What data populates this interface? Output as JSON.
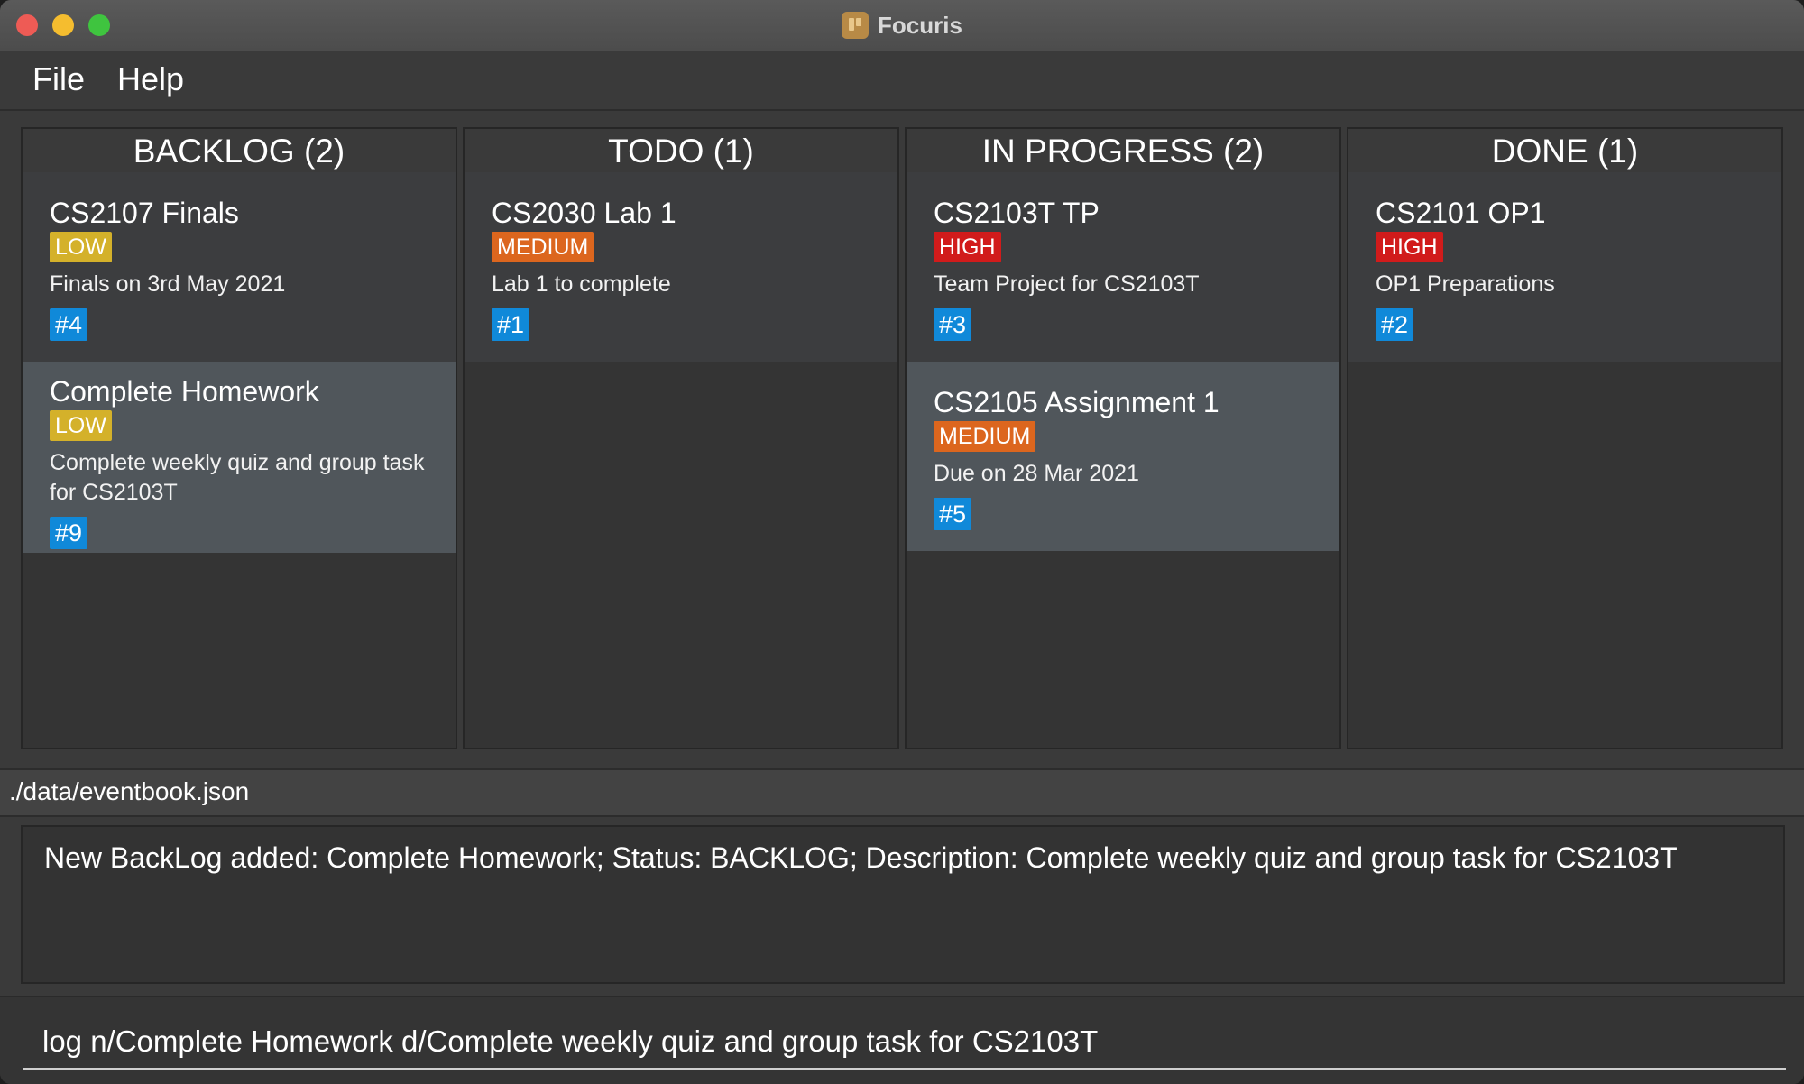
{
  "window": {
    "title": "Focuris"
  },
  "menu": [
    "File",
    "Help"
  ],
  "columns": [
    {
      "header": "BACKLOG (2)",
      "cards": [
        {
          "title": "CS2107 Finals",
          "priority": "LOW",
          "description": "Finals on 3rd May 2021",
          "id": "#4"
        },
        {
          "title": "Complete Homework",
          "priority": "LOW",
          "description": "Complete weekly quiz and group task for CS2103T",
          "id": "#9"
        }
      ]
    },
    {
      "header": "TODO (1)",
      "cards": [
        {
          "title": "CS2030 Lab 1",
          "priority": "MEDIUM",
          "description": "Lab 1 to complete",
          "id": "#1"
        }
      ]
    },
    {
      "header": "IN PROGRESS (2)",
      "cards": [
        {
          "title": "CS2103T TP",
          "priority": "HIGH",
          "description": "Team Project for CS2103T",
          "id": "#3"
        },
        {
          "title": "CS2105 Assignment 1",
          "priority": "MEDIUM",
          "description": "Due on 28 Mar 2021",
          "id": "#5"
        }
      ]
    },
    {
      "header": "DONE (1)",
      "cards": [
        {
          "title": "CS2101 OP1",
          "priority": "HIGH",
          "description": "OP1 Preparations",
          "id": "#2"
        }
      ]
    }
  ],
  "status": {
    "path": "./data/eventbook.json"
  },
  "result": {
    "message": "New BackLog added: Complete Homework; Status: BACKLOG; Description: Complete weekly quiz and group task for CS2103T"
  },
  "command": {
    "value": "log n/Complete Homework d/Complete weekly quiz and group task for CS2103T"
  },
  "colors": {
    "low": "#d4b12a",
    "medium": "#dc661e",
    "high": "#d11b1b",
    "id_badge": "#1089d9"
  }
}
